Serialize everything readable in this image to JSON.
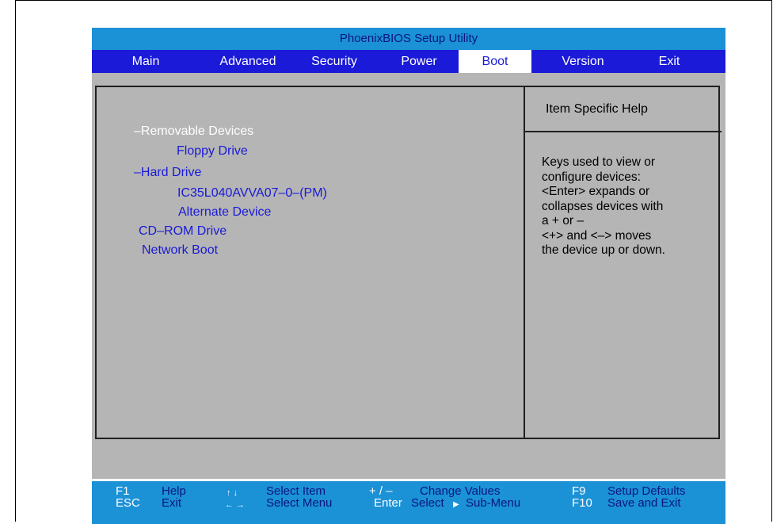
{
  "title": "PhoenixBIOS Setup Utility",
  "menu": [
    {
      "label": "Main",
      "active": false
    },
    {
      "label": "Advanced",
      "active": false
    },
    {
      "label": "Security",
      "active": false
    },
    {
      "label": "Power",
      "active": false
    },
    {
      "label": "Boot",
      "active": true
    },
    {
      "label": "Version",
      "active": false
    },
    {
      "label": "Exit",
      "active": false
    }
  ],
  "boot_list": {
    "removable_devices": "–Removable Devices",
    "floppy_drive": "Floppy Drive",
    "hard_drive": "–Hard Drive",
    "ic35": "IC35L040AVVA07–0–(PM)",
    "alternate_device": "Alternate Device",
    "cdrom_drive": "CD–ROM Drive",
    "network_boot": "Network Boot"
  },
  "help": {
    "title": "Item Specific Help",
    "lines": [
      "Keys used to view or",
      "configure devices:",
      "<Enter> expands or",
      "collapses devices with",
      "a + or –",
      "<+> and <–>  moves",
      "the device up or down."
    ]
  },
  "statusbar": {
    "f1": "F1",
    "help": "Help",
    "esc": "ESC",
    "exit": "Exit",
    "updown_arrows": "↑ ↓",
    "select_item": "Select Item",
    "leftright_arrows": "← →",
    "select_menu": "Select Menu",
    "plusminus": "+ / –",
    "change_values": "Change Values",
    "enter": "Enter",
    "select_submenu_prefix": "Select",
    "submenu_arrow": "▶",
    "select_submenu": "Sub-Menu",
    "f9": "F9",
    "setup_defaults": "Setup Defaults",
    "f10": "F10",
    "save_exit": "Save and Exit"
  },
  "colors": {
    "title_bg": "#1b91d6",
    "menu_bg": "#1a1ad8",
    "body_bg": "#b5b5b5",
    "item_color": "#1a1ad8"
  }
}
